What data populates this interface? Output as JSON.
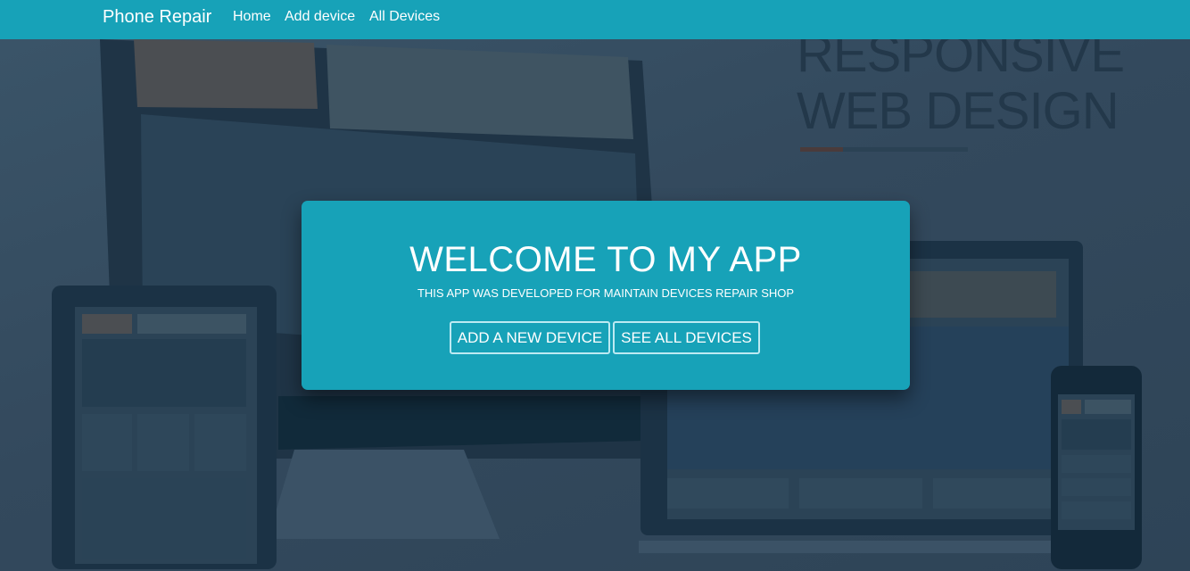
{
  "navbar": {
    "brand": "Phone Repair",
    "links": [
      {
        "label": "Home"
      },
      {
        "label": "Add device"
      },
      {
        "label": "All Devices"
      }
    ]
  },
  "background": {
    "heading_line1": "RESPONSIVE",
    "heading_line2": "WEB DESIGN"
  },
  "welcome_card": {
    "title": "WELCOME TO MY APP",
    "subtitle": "THIS APP WAS DEVELOPED FOR MAINTAIN DEVICES REPAIR SHOP",
    "buttons": [
      {
        "label": "ADD A NEW DEVICE"
      },
      {
        "label": "SEE ALL DEVICES"
      }
    ]
  },
  "colors": {
    "accent": "#17a2b8",
    "background": "#33495d",
    "text": "#ffffff"
  }
}
